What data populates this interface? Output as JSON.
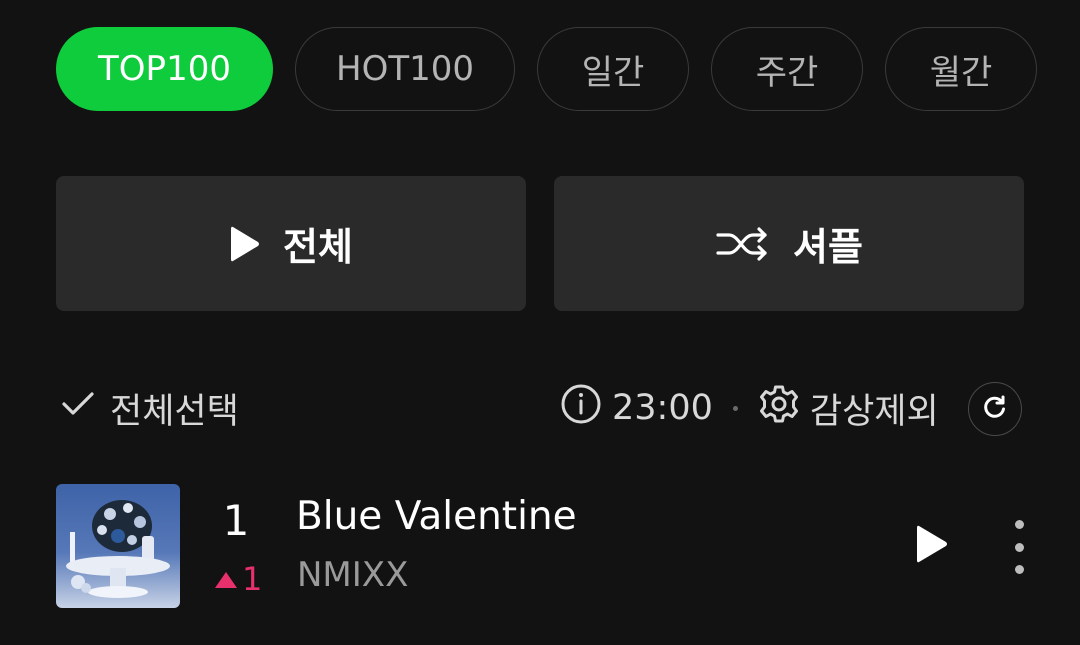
{
  "tabs": [
    {
      "label": "TOP100",
      "active": true
    },
    {
      "label": "HOT100",
      "active": false
    },
    {
      "label": "일간",
      "active": false
    },
    {
      "label": "주간",
      "active": false
    },
    {
      "label": "월간",
      "active": false
    }
  ],
  "actions": {
    "play_all_label": "전체",
    "shuffle_label": "셔플"
  },
  "toolbar": {
    "select_all_label": "전체선택",
    "update_time": "23:00",
    "exclude_label": "감상제외"
  },
  "songs": [
    {
      "rank": "1",
      "change": "1",
      "change_direction": "up",
      "title": "Blue Valentine",
      "artist": "NMIXX"
    }
  ],
  "colors": {
    "accent": "#0fcc3c",
    "rank_up": "#e8316c",
    "background": "#121212",
    "button_bg": "#2a2a2a"
  },
  "icons": {
    "play_all": "play-icon",
    "shuffle": "shuffle-icon",
    "select_all": "check-icon",
    "info": "info-icon",
    "settings": "gear-icon",
    "refresh": "refresh-icon",
    "rank_change": "triangle-up-icon",
    "row_play": "play-icon",
    "more": "more-vertical-icon"
  }
}
